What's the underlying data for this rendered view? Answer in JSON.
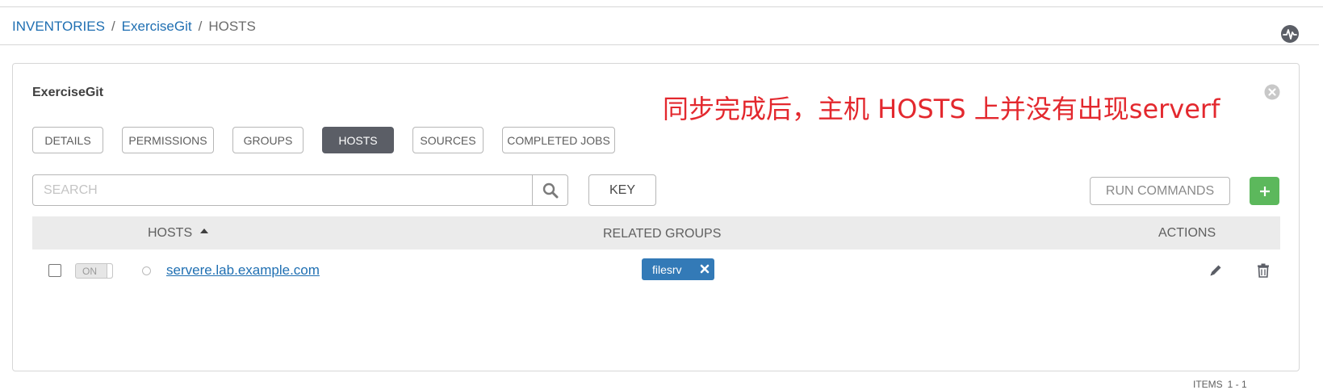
{
  "breadcrumb": {
    "items": [
      "INVENTORIES",
      "ExerciseGit",
      "HOSTS"
    ],
    "separator": "/"
  },
  "panel": {
    "title": "ExerciseGit",
    "annotation": "同步完成后，主机 HOSTS 上并没有出现serverf"
  },
  "tabs": [
    {
      "label": "DETAILS",
      "active": false
    },
    {
      "label": "PERMISSIONS",
      "active": false
    },
    {
      "label": "GROUPS",
      "active": false
    },
    {
      "label": "HOSTS",
      "active": true
    },
    {
      "label": "SOURCES",
      "active": false
    },
    {
      "label": "COMPLETED JOBS",
      "active": false
    }
  ],
  "toolbar": {
    "search_placeholder": "SEARCH",
    "key_label": "KEY",
    "run_commands_label": "RUN COMMANDS",
    "add_label": "+"
  },
  "table": {
    "columns": {
      "hosts": "HOSTS",
      "related_groups": "RELATED GROUPS",
      "actions": "ACTIONS"
    },
    "sort_column": "hosts",
    "sort_direction": "ascending",
    "rows": [
      {
        "toggle": "ON",
        "host": "servere.lab.example.com",
        "groups": [
          "filesrv"
        ]
      }
    ]
  },
  "pagination": {
    "label": "ITEMS",
    "range": "1 - 1"
  },
  "colors": {
    "link": "#1f6fb2",
    "active_tab": "#5b5e66",
    "add_button": "#5cb85c",
    "group_tag": "#337ab7",
    "annotation": "#e3282e"
  }
}
